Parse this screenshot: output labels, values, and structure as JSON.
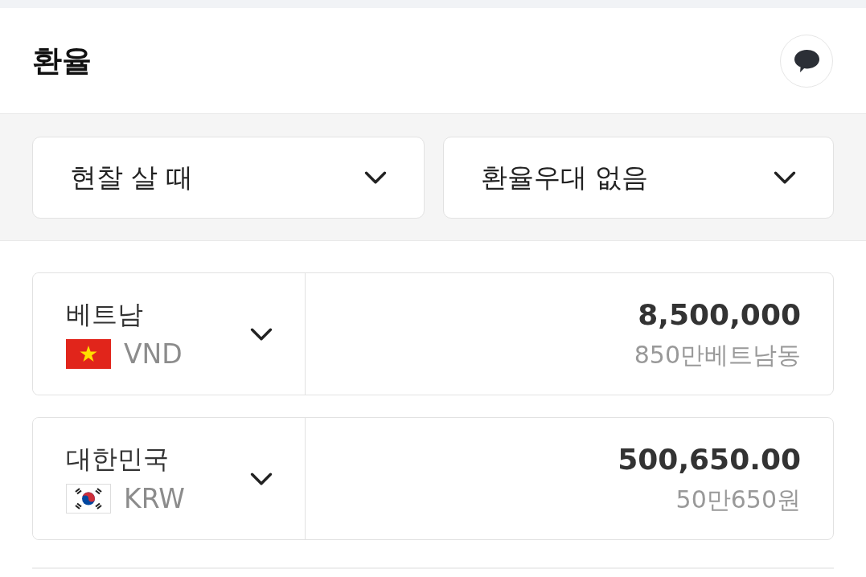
{
  "header": {
    "title": "환율"
  },
  "filters": [
    {
      "label": "현찰 살 때"
    },
    {
      "label": "환율우대 없음"
    }
  ],
  "currencies": [
    {
      "country": "베트남",
      "code": "VND",
      "kind": "vn",
      "amount": "8,500,000",
      "amount_words": "850만베트남동"
    },
    {
      "country": "대한민국",
      "code": "KRW",
      "kind": "kr",
      "amount": "500,650.00",
      "amount_words": "50만650원"
    }
  ]
}
